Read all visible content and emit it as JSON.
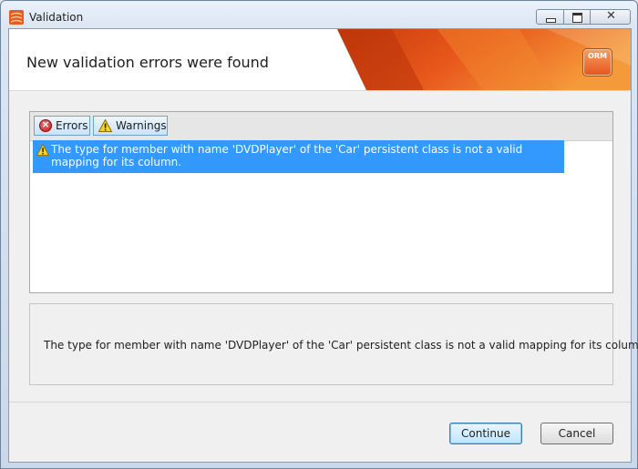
{
  "window": {
    "title": "Validation"
  },
  "banner": {
    "heading": "New validation errors were found",
    "logo_text": "ORM"
  },
  "tabs": [
    {
      "label": "Errors",
      "icon": "error-icon"
    },
    {
      "label": "Warnings",
      "icon": "warning-icon"
    }
  ],
  "messages": [
    {
      "icon": "warning-icon",
      "text": "The type for member with name 'DVDPlayer' of the 'Car' persistent class is not a valid mapping for its column.",
      "selected": true
    }
  ],
  "details": {
    "text": "The type for member with name 'DVDPlayer' of the 'Car' persistent class is not a valid mapping for its column."
  },
  "buttons": {
    "continue_label": "Continue",
    "cancel_label": "Cancel"
  },
  "colors": {
    "selection": "#3399ff",
    "banner_accent": "#e8581c"
  }
}
